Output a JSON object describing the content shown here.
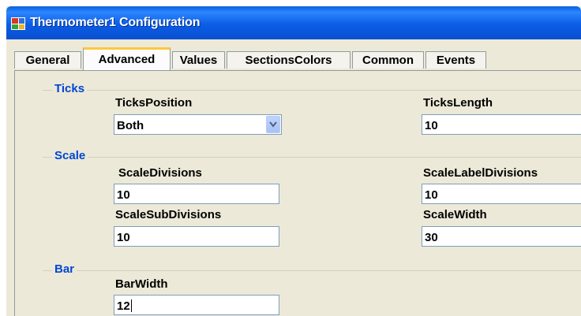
{
  "window": {
    "title": "Thermometer1 Configuration"
  },
  "tabs": [
    {
      "label": "General"
    },
    {
      "label": "Advanced"
    },
    {
      "label": "Values"
    },
    {
      "label": "SectionsColors"
    },
    {
      "label": "Common"
    },
    {
      "label": "Events"
    }
  ],
  "active_tab": "Advanced",
  "ticks": {
    "group_label": "Ticks",
    "position_label": "TicksPosition",
    "position_value": "Both",
    "length_label": "TicksLength",
    "length_value": "10"
  },
  "scale": {
    "group_label": "Scale",
    "divisions_label": "ScaleDivisions",
    "divisions_value": "10",
    "label_divisions_label": "ScaleLabelDivisions",
    "label_divisions_value": "10",
    "subdivisions_label": "ScaleSubDivisions",
    "subdivisions_value": "10",
    "width_label": "ScaleWidth",
    "width_value": "30"
  },
  "bar": {
    "group_label": "Bar",
    "width_label": "BarWidth",
    "width_value": "12"
  },
  "colors": {
    "group_label_color": "#0046d5",
    "active_tab_accent": "#ffc83c",
    "titlebar": "#0a5fdc"
  }
}
